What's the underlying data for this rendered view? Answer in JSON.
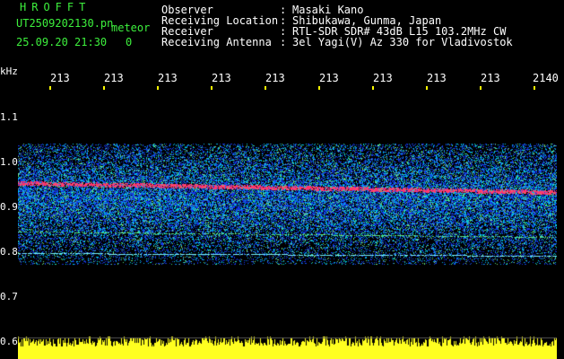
{
  "header": {
    "app_title": "HROFFT",
    "file_name": "UT2509202130.pn",
    "file_suffix": "meteor",
    "date_time": "25.09.20 21:30",
    "status_value": "0",
    "metadata": [
      {
        "label": "Observer",
        "value": "Masaki Kano"
      },
      {
        "label": "Receiving Location",
        "value": "Shibukawa, Gunma, Japan"
      },
      {
        "label": "Receiver",
        "value": "RTL-SDR SDR# 43dB L15 103.2MHz CW"
      },
      {
        "label": "Receiving Antenna",
        "value": "3el Yagi(V) Az 330 for Vladivostok"
      }
    ]
  },
  "axes": {
    "y_unit": "kHz",
    "y_ticks": [
      "1.1",
      "1.0",
      "0.9",
      "0.8",
      "0.7",
      "0.6"
    ],
    "x_ticks": [
      "213",
      "213",
      "213",
      "213",
      "213",
      "213",
      "213",
      "213",
      "213",
      "2140"
    ]
  },
  "colors": {
    "header_green": "#3df03d",
    "tick_yellow": "#ffff00",
    "signal_red": "#ff2a5a",
    "noise_blue": "#1a3cff",
    "noise_cyan": "#00c8ff",
    "baseline_yellow": "#ffff20"
  }
}
